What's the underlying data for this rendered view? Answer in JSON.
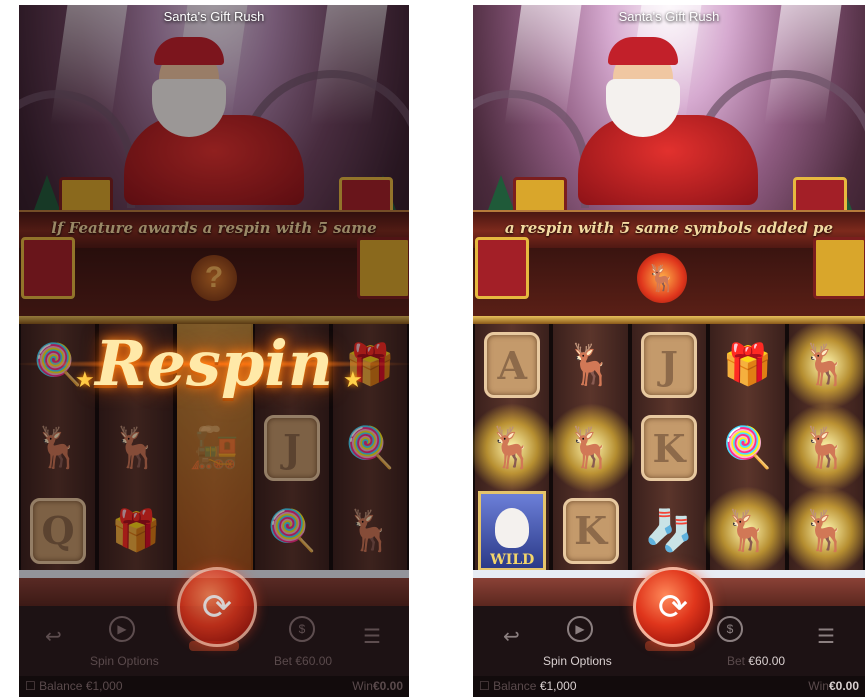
{
  "left_panel": {
    "title": "Santa's Gift Rush",
    "banner_text": "lf Feature awards a respin with 5 same",
    "respin_text": "Respin",
    "mystery_symbol": "?",
    "reels": [
      [
        {
          "icon": "candy-cane-icon",
          "glyph": "🍭"
        },
        {
          "icon": "reindeer-icon",
          "glyph": "🦌"
        },
        {
          "icon": "letter-q",
          "letter": "Q"
        }
      ],
      [
        {
          "icon": "empty",
          "glyph": ""
        },
        {
          "icon": "reindeer-icon",
          "glyph": "🦌"
        },
        {
          "icon": "gift-box-icon",
          "glyph": "🎁"
        }
      ],
      [
        {
          "icon": "empty",
          "glyph": ""
        },
        {
          "icon": "train-icon",
          "glyph": "🚂"
        },
        {
          "icon": "empty",
          "glyph": ""
        }
      ],
      [
        {
          "icon": "empty",
          "glyph": ""
        },
        {
          "icon": "letter-j",
          "letter": "J"
        },
        {
          "icon": "candy-cane-icon",
          "glyph": "🍭"
        }
      ],
      [
        {
          "icon": "gift-box-icon",
          "glyph": "🎁"
        },
        {
          "icon": "candy-cane-icon",
          "glyph": "🍭"
        },
        {
          "icon": "reindeer-icon",
          "glyph": "🦌"
        }
      ]
    ],
    "controls": {
      "spin_options_label": "Spin Options",
      "bet_label": "Bet",
      "bet_value": "€60.00",
      "balance_label": "Balance",
      "balance_value": "€1,000",
      "win_label": "Win",
      "win_value": "€0.00"
    }
  },
  "right_panel": {
    "title": "Santa's Gift Rush",
    "banner_text": "a respin with 5 same symbols added pe",
    "reels": [
      [
        {
          "icon": "letter-a",
          "letter": "A"
        },
        {
          "icon": "reindeer-icon",
          "glyph": "🦌",
          "highlight": true
        },
        {
          "icon": "wild-icon",
          "wild_label": "WILD"
        }
      ],
      [
        {
          "icon": "reindeer-icon",
          "glyph": "🦌"
        },
        {
          "icon": "reindeer-icon",
          "glyph": "🦌",
          "highlight": true
        },
        {
          "icon": "letter-k",
          "letter": "K"
        }
      ],
      [
        {
          "icon": "letter-j",
          "letter": "J"
        },
        {
          "icon": "letter-k",
          "letter": "K"
        },
        {
          "icon": "stocking-icon",
          "glyph": "🧦"
        }
      ],
      [
        {
          "icon": "gift-box-icon",
          "glyph": "🎁"
        },
        {
          "icon": "candy-cane-icon",
          "glyph": "🍭"
        },
        {
          "icon": "reindeer-icon",
          "glyph": "🦌",
          "highlight": true
        }
      ],
      [
        {
          "icon": "reindeer-icon",
          "glyph": "🦌",
          "highlight": true
        },
        {
          "icon": "reindeer-icon",
          "glyph": "🦌",
          "highlight": true
        },
        {
          "icon": "reindeer-icon",
          "glyph": "🦌",
          "highlight": true
        }
      ]
    ],
    "controls": {
      "spin_options_label": "Spin Options",
      "bet_label": "Bet",
      "bet_value": "€60.00",
      "balance_label": "Balance",
      "balance_value": "€1,000",
      "win_label": "Win",
      "win_value": "€0.00"
    }
  },
  "colors": {
    "accent_gold": "#e8c15b",
    "spin_red": "#e0361c",
    "highlight_glow": "#ffd23a"
  }
}
